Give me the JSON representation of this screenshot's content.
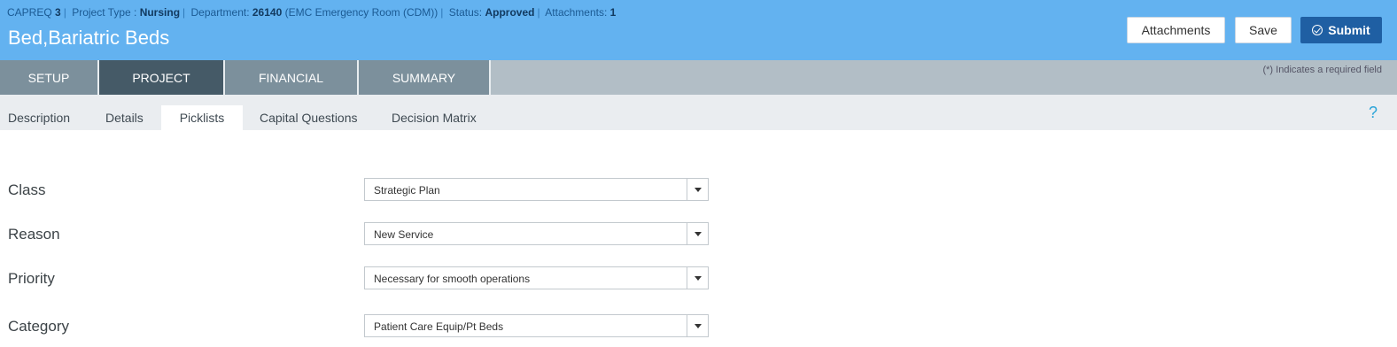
{
  "meta": {
    "capreq_label": "CAPREQ",
    "capreq_value": "3",
    "project_type_label": "Project Type :",
    "project_type_value": "Nursing",
    "department_label": "Department:",
    "department_value": "26140",
    "department_name": "(EMC Emergency Room (CDM))",
    "status_label": "Status:",
    "status_value": "Approved",
    "attachments_label": "Attachments:",
    "attachments_value": "1"
  },
  "title": "Bed,Bariatric Beds",
  "buttons": {
    "attachments": "Attachments",
    "save": "Save",
    "submit": "Submit"
  },
  "main_tabs": [
    "SETUP",
    "PROJECT",
    "FINANCIAL",
    "SUMMARY"
  ],
  "active_main_tab": "PROJECT",
  "required_note": "(*) Indicates a required field",
  "sub_tabs": [
    "Description",
    "Details",
    "Picklists",
    "Capital Questions",
    "Decision Matrix"
  ],
  "active_sub_tab": "Picklists",
  "help": "?",
  "fields": [
    {
      "label": "Class",
      "value": "Strategic Plan"
    },
    {
      "label": "Reason",
      "value": "New Service"
    },
    {
      "label": "Priority",
      "value": "Necessary for smooth operations"
    },
    {
      "label": "Category",
      "value": "Patient Care Equip/Pt Beds"
    }
  ],
  "colors": {
    "header": "#63b2f0",
    "active_tab": "#455a67",
    "submit": "#1f5fa3"
  }
}
